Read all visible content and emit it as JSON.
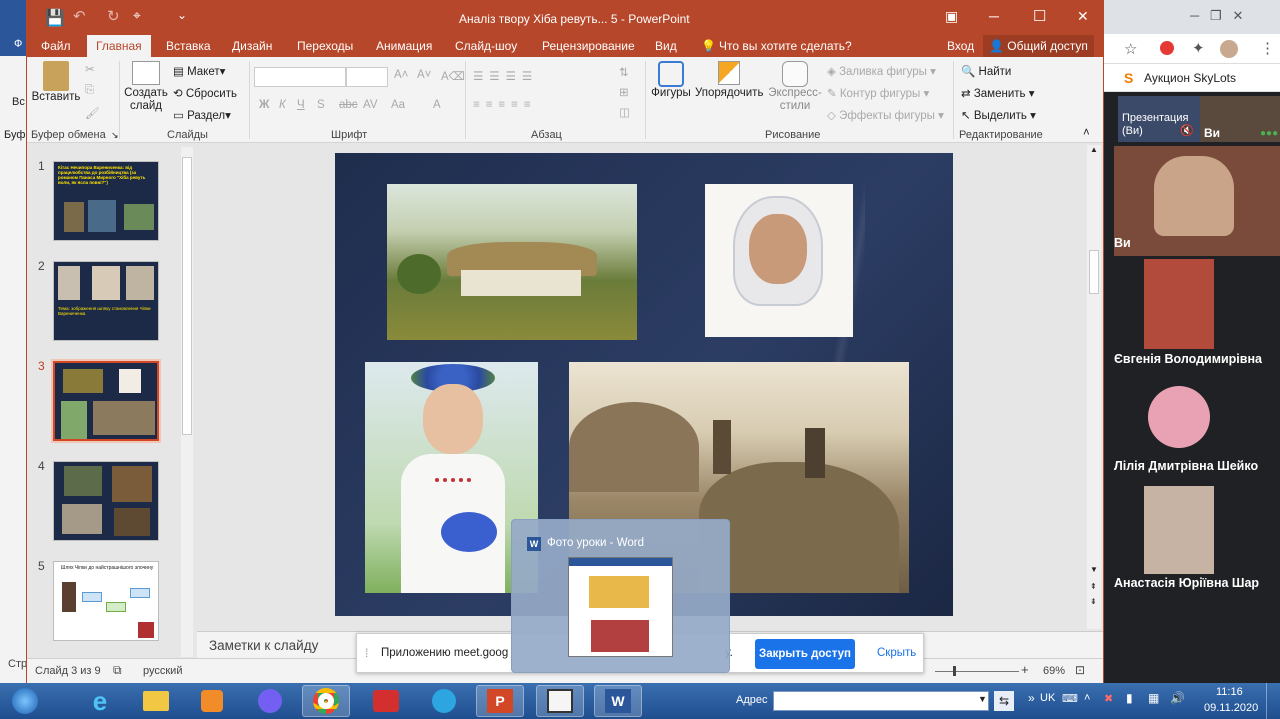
{
  "window": {
    "title": "Аналіз твору Хіба ревуть... 5 - PowerPoint",
    "controls": {
      "minimize": "─",
      "maximize": "☐",
      "close": "✕"
    }
  },
  "ribbon_tabs": [
    "Файл",
    "Главная",
    "Вставка",
    "Дизайн",
    "Переходы",
    "Анимация",
    "Слайд-шоу",
    "Рецензирование",
    "Вид"
  ],
  "tell_me": "Что вы хотите сделать?",
  "sign_in": "Вход",
  "share_btn": "Общий доступ",
  "ribbon": {
    "clipboard": {
      "paste": "Вставить",
      "label": "Буфер обмена"
    },
    "slides": {
      "new_slide": "Создать слайд",
      "layout": "Макет",
      "reset": "Сбросить",
      "section": "Раздел",
      "label": "Слайды"
    },
    "font": {
      "label": "Шрифт",
      "bold": "Ж",
      "italic": "К",
      "underline": "Ч",
      "strike": "S",
      "abc": "abc",
      "aa": "Aa",
      "a": "A"
    },
    "paragraph": {
      "label": "Абзац"
    },
    "drawing": {
      "shapes": "Фигуры",
      "arrange": "Упорядочить",
      "quick_styles": "Экспресс-стили",
      "fill": "Заливка фигуры",
      "outline": "Контур фигуры",
      "effects": "Эффекты фигуры",
      "label": "Рисование"
    },
    "editing": {
      "find": "Найти",
      "replace": "Заменить",
      "select": "Выделить",
      "label": "Редактирование"
    }
  },
  "slides": [
    {
      "num": "1",
      "title": "Кітас Нечипора Варениченка: від працелюбства до розбійництва (за романом Панаса Мирного \"Хіба ревуть воли, як ясла повні?\")"
    },
    {
      "num": "2",
      "title": "Тема: зображення шляху становлення Чіпки Варениченка"
    },
    {
      "num": "3"
    },
    {
      "num": "4"
    },
    {
      "num": "5",
      "title": "Шлях Чіпки до найстрашнішого злочину"
    }
  ],
  "notes_placeholder": "Заметки к слайду",
  "status": {
    "slide_info": "Слайд 3 из 9",
    "language": "русский",
    "zoom": "69%",
    "left_cut": "Стр"
  },
  "share_notice": {
    "text": "Приложению meet.goog",
    "suffix": "у.",
    "stop": "Закрыть доступ",
    "hide": "Скрыть"
  },
  "hover_preview": {
    "title": "Фото уроки - Word"
  },
  "browser": {
    "bookmark": "Аукцион SkyLots"
  },
  "meet": {
    "presenting": "Презентация (Ви)",
    "you": "Ви",
    "participants": [
      "Ви",
      "Євгенія Володимирівна",
      "Лілія Дмитрівна Шейко",
      "Анастасія Юріївна Шар"
    ]
  },
  "taskbar": {
    "address_label": "Адрес",
    "lang": "UK",
    "time": "11:16",
    "date": "09.11.2020"
  },
  "colors": {
    "ppt_accent": "#b7472a",
    "share_blue": "#1a73e8"
  }
}
